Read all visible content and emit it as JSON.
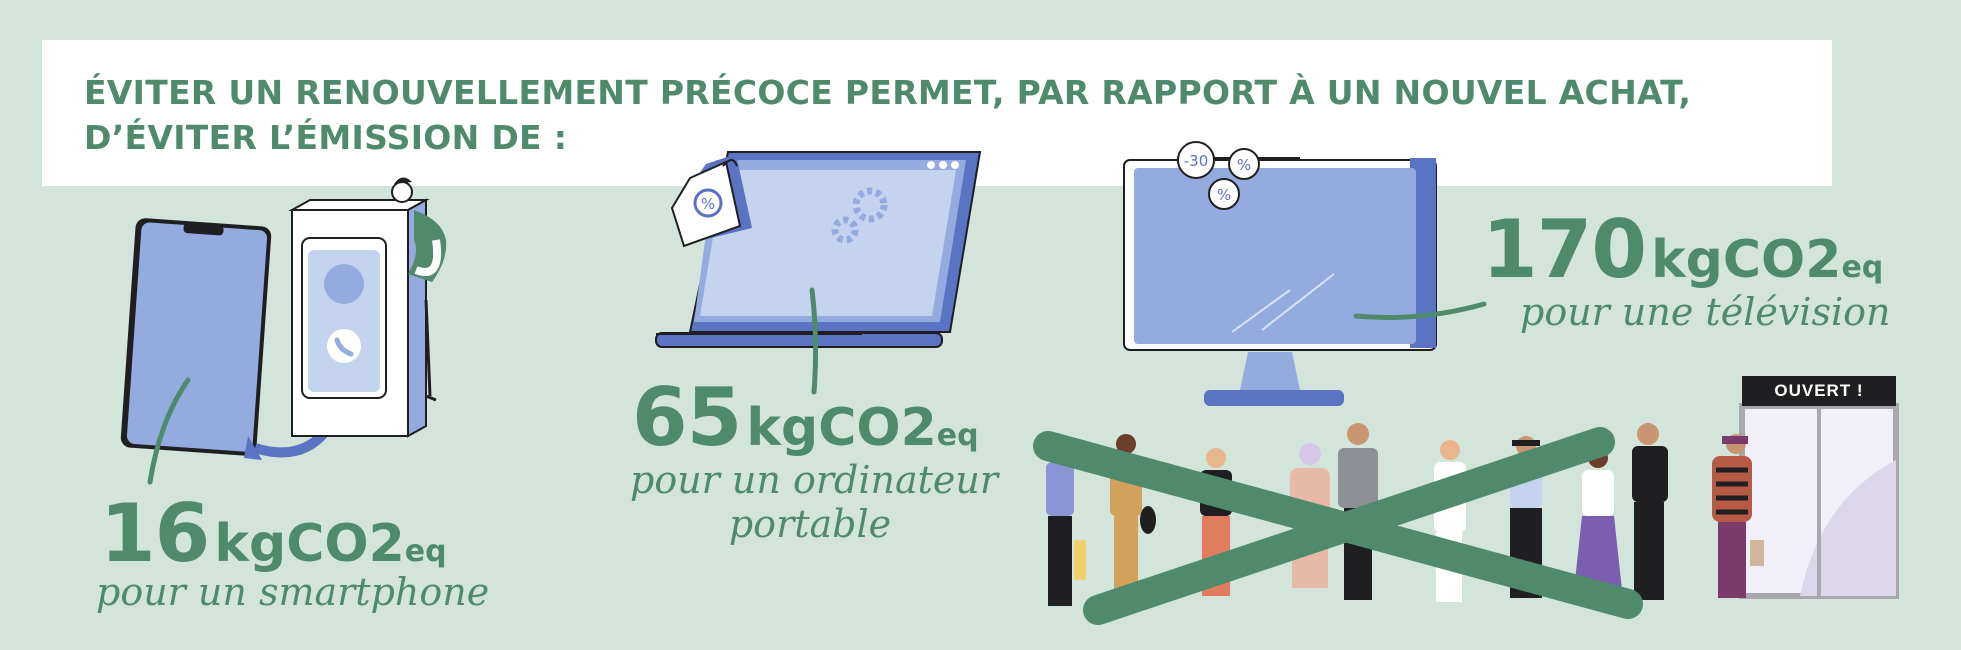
{
  "header": {
    "line1": "ÉVITER UN RENOUVELLEMENT PRÉCOCE PERMET, PAR RAPPORT À UN NOUVEL ACHAT,",
    "line2": "D’ÉVITER L’ÉMISSION DE :"
  },
  "items": [
    {
      "value": "16",
      "unit": "kgCO2",
      "unit_sub": "eq",
      "caption": "pour un smartphone"
    },
    {
      "value": "65",
      "unit": "kgCO2",
      "unit_sub": "eq",
      "caption_line1": "pour un ordinateur",
      "caption_line2": "portable"
    },
    {
      "value": "170",
      "unit": "kgCO2",
      "unit_sub": "eq",
      "caption": "pour une télévision"
    }
  ],
  "tv_tags": [
    "-30",
    "%",
    "%"
  ],
  "laptop_tag": "%",
  "store_sign": "OUVERT !",
  "colors": {
    "background": "#d3e4da",
    "green": "#4e8a6b",
    "device_blue": "#94abdf",
    "device_light": "#c4d3ee",
    "device_dark": "#5a73c3"
  },
  "icons": [
    "smartphone-icon",
    "phone-box-icon",
    "laptop-icon",
    "gear-icon",
    "price-tag-icon",
    "television-icon",
    "shopping-crowd-illustration",
    "store-door-icon"
  ]
}
